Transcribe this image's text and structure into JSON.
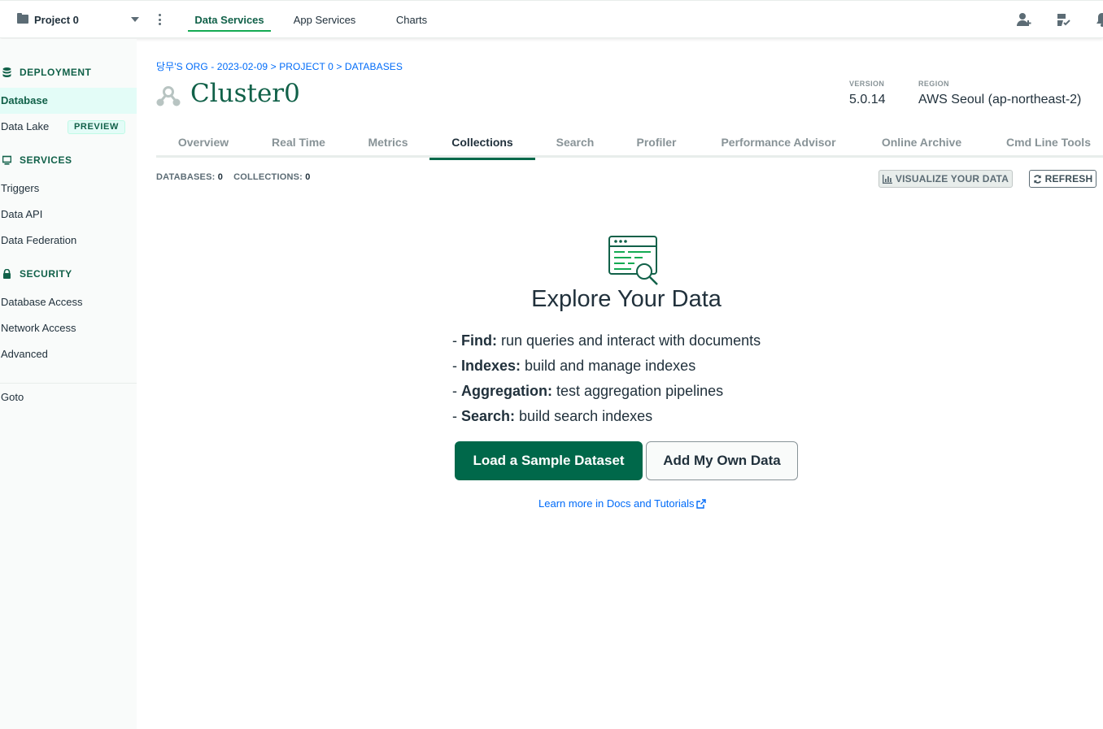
{
  "topbar": {
    "project_name": "Project 0",
    "tabs": [
      {
        "label": "Data Services",
        "active": true
      },
      {
        "label": "App Services",
        "active": false
      },
      {
        "label": "Charts",
        "active": false
      }
    ],
    "icons": [
      "invite-user-icon",
      "activity-feed-icon",
      "notifications-bell-icon"
    ]
  },
  "sidebar": {
    "sections": [
      {
        "title": "DEPLOYMENT",
        "icon": "database-stack-icon",
        "items": [
          {
            "label": "Database",
            "active": true
          },
          {
            "label": "Data Lake",
            "badge": "PREVIEW"
          }
        ]
      },
      {
        "title": "SERVICES",
        "icon": "monitor-icon",
        "items": [
          {
            "label": "Triggers"
          },
          {
            "label": "Data API"
          },
          {
            "label": "Data Federation"
          }
        ]
      },
      {
        "title": "SECURITY",
        "icon": "lock-icon",
        "items": [
          {
            "label": "Database Access"
          },
          {
            "label": "Network Access"
          },
          {
            "label": "Advanced"
          }
        ]
      }
    ],
    "goto": "Goto"
  },
  "breadcrumb": {
    "org": "당무'S ORG - 2023-02-09",
    "sep": ">",
    "project": "PROJECT 0",
    "page": "DATABASES"
  },
  "cluster": {
    "name": "Cluster0",
    "version_label": "VERSION",
    "version": "5.0.14",
    "region_label": "REGION",
    "region": "AWS Seoul (ap-northeast-2)"
  },
  "tabs": [
    {
      "label": "Overview"
    },
    {
      "label": "Real Time"
    },
    {
      "label": "Metrics"
    },
    {
      "label": "Collections",
      "active": true
    },
    {
      "label": "Search"
    },
    {
      "label": "Profiler"
    },
    {
      "label": "Performance Advisor"
    },
    {
      "label": "Online Archive"
    },
    {
      "label": "Cmd Line Tools"
    }
  ],
  "counts": {
    "databases_label": "DATABASES:",
    "databases": "0",
    "collections_label": "COLLECTIONS:",
    "collections": "0"
  },
  "actions": {
    "visualize": "VISUALIZE YOUR DATA",
    "refresh": "REFRESH"
  },
  "empty_state": {
    "title": "Explore Your Data",
    "bullets": [
      {
        "prefix": "- ",
        "term": "Find:",
        "text": " run queries and interact with documents"
      },
      {
        "prefix": "- ",
        "term": "Indexes:",
        "text": " build and manage indexes"
      },
      {
        "prefix": "- ",
        "term": "Aggregation:",
        "text": " test aggregation pipelines"
      },
      {
        "prefix": "- ",
        "term": "Search:",
        "text": " build search indexes"
      }
    ],
    "primary_button": "Load a Sample Dataset",
    "secondary_button": "Add My Own Data",
    "learn_link": "Learn more in Docs and Tutorials"
  },
  "colors": {
    "brand_green": "#00684a",
    "dark_green": "#116149",
    "link_blue": "#016bf8",
    "mint": "#e3fcf7"
  }
}
